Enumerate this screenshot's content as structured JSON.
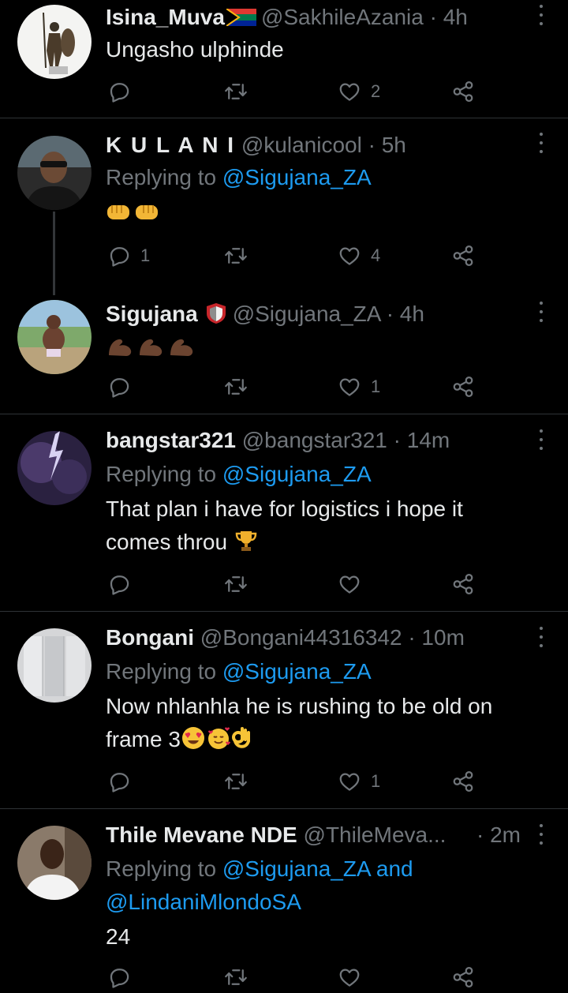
{
  "tweets": [
    {
      "name": "Isina_Muva",
      "handle": "@SakhileAzania",
      "time": "· 4h",
      "replying_prefix": "",
      "replying_to": "",
      "text": "Ungasho ulphinde",
      "reply_count": "",
      "like_count": "2"
    },
    {
      "name": "K U L A N I",
      "handle": "@kulanicool",
      "time": "· 5h",
      "replying_prefix": "Replying to",
      "replying_to": "@Sigujana_ZA",
      "text": "",
      "reply_count": "1",
      "like_count": "4"
    },
    {
      "name": "Sigujana",
      "handle": "@Sigujana_ZA",
      "time": "· 4h",
      "replying_prefix": "",
      "replying_to": "",
      "text": "",
      "reply_count": "",
      "like_count": "1"
    },
    {
      "name": "bangstar321",
      "handle": "@bangstar321",
      "time": "· 14m",
      "replying_prefix": "Replying to",
      "replying_to": "@Sigujana_ZA",
      "text_line1": "That plan i have for logistics i hope it",
      "text_line2": "comes throu",
      "reply_count": "",
      "like_count": ""
    },
    {
      "name": "Bongani",
      "handle": "@Bongani44316342",
      "time": "· 10m",
      "replying_prefix": "Replying to",
      "replying_to": "@Sigujana_ZA",
      "text_line1": "Now nhlanhla he is rushing to be old on",
      "text_line2": "frame 3",
      "reply_count": "",
      "like_count": "1"
    },
    {
      "name": "Thile Mevane NDE",
      "handle": "@ThileMeva...",
      "time": "· 2m",
      "replying_prefix": "Replying to",
      "replying_to": "@Sigujana_ZA",
      "replying_and": "and",
      "replying_to_2": "@LindaniMlondoSA",
      "text": "24",
      "reply_count": "",
      "like_count": ""
    }
  ],
  "icons": {
    "reply": "reply-icon",
    "retweet": "retweet-icon",
    "like": "heart-icon",
    "share": "share-icon",
    "more": "more-icon"
  },
  "colors": {
    "background": "#000000",
    "text": "#e7e9ea",
    "muted": "#71767b",
    "link": "#1d9bf0",
    "divider": "#2f3336"
  }
}
